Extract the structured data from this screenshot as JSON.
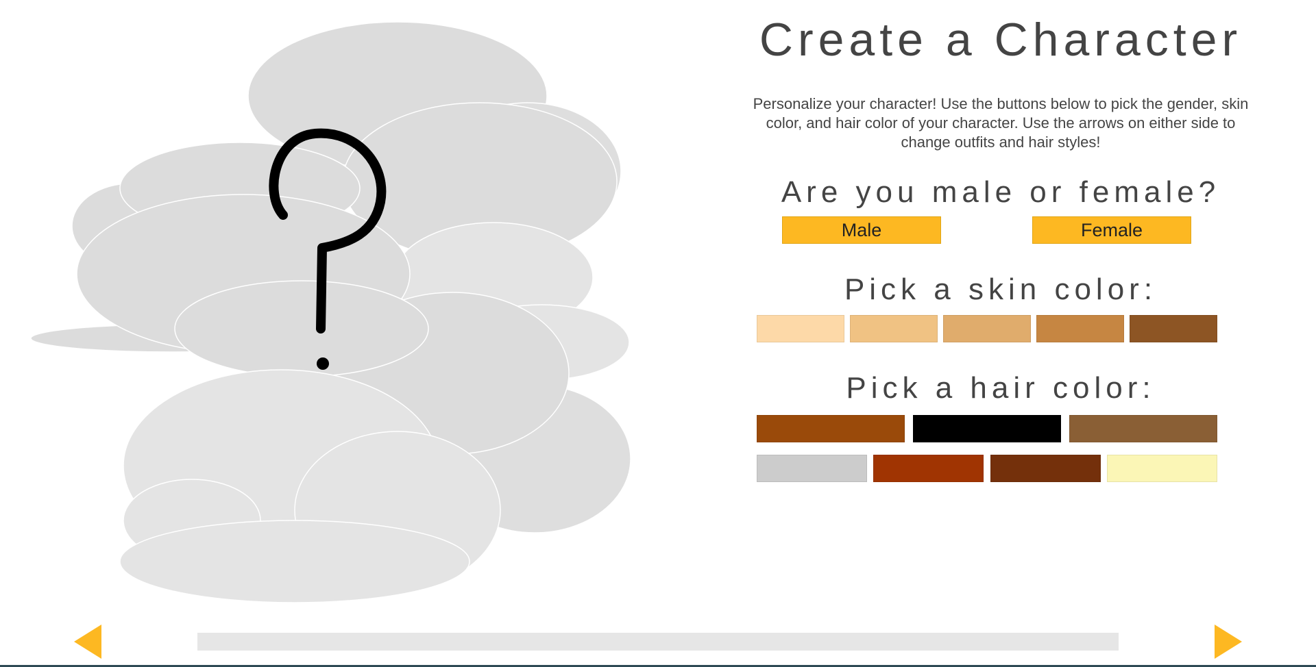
{
  "header": {
    "title": "Create a Character"
  },
  "intro": {
    "text": "Personalize your character! Use the buttons below to pick the gender, skin color, and hair color of your character. Use the arrows on either side to change outfits and hair styles!"
  },
  "gender": {
    "heading": "Are you male or female?",
    "male_label": "Male",
    "female_label": "Female",
    "button_color": "#FDB822"
  },
  "skin": {
    "heading": "Pick a skin color:",
    "colors": [
      "#FDD9A8",
      "#F0C283",
      "#E0AC6C",
      "#C68642",
      "#8D5524"
    ]
  },
  "hair": {
    "heading": "Pick a hair color:",
    "row1_colors": [
      "#9A4A0A",
      "#000000",
      "#8A5F35"
    ],
    "row2_colors": [
      "#CCCCCC",
      "#A03402",
      "#74300B",
      "#FBF6B6"
    ]
  },
  "preview": {
    "placeholder_icon": "question-mark-icon",
    "cloud_color": "#e2e2e2"
  },
  "navigation": {
    "prev_icon": "triangle-left-icon",
    "next_icon": "triangle-right-icon",
    "accent": "#FDB822"
  }
}
